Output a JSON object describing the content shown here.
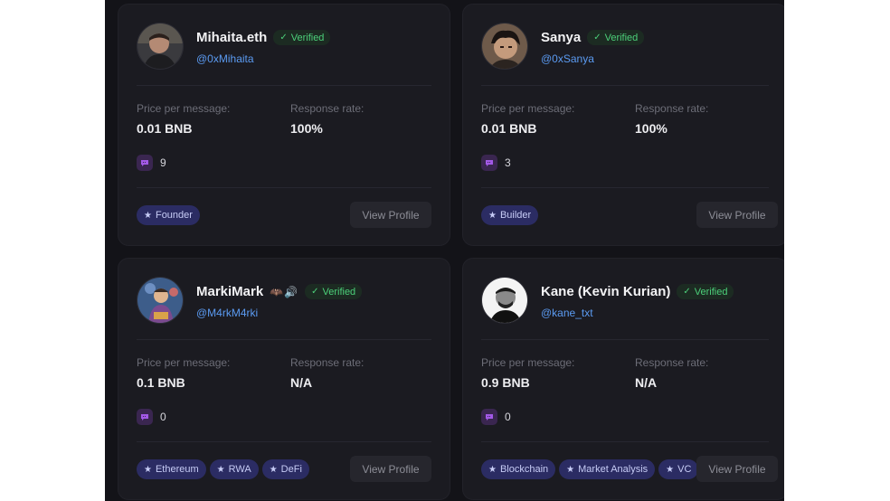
{
  "profiles": [
    {
      "name": "Mihaita.eth",
      "emoji": "",
      "verified_label": "Verified",
      "handle": "@0xMihaita",
      "price_label": "Price per message:",
      "price": "0.01 BNB",
      "response_label": "Response rate:",
      "response": "100%",
      "messages": "9",
      "tags": [
        "Founder"
      ],
      "button": "View Profile"
    },
    {
      "name": "Sanya",
      "emoji": "",
      "verified_label": "Verified",
      "handle": "@0xSanya",
      "price_label": "Price per message:",
      "price": "0.01 BNB",
      "response_label": "Response rate:",
      "response": "100%",
      "messages": "3",
      "tags": [
        "Builder"
      ],
      "button": "View Profile"
    },
    {
      "name": "MarkiMark",
      "emoji": "🦇🔊",
      "verified_label": "Verified",
      "handle": "@M4rkM4rki",
      "price_label": "Price per message:",
      "price": "0.1 BNB",
      "response_label": "Response rate:",
      "response": "N/A",
      "messages": "0",
      "tags": [
        "Ethereum",
        "RWA",
        "DeFi"
      ],
      "button": "View Profile"
    },
    {
      "name": "Kane (Kevin Kurian)",
      "emoji": "",
      "verified_label": "Verified",
      "handle": "@kane_txt",
      "price_label": "Price per message:",
      "price": "0.9 BNB",
      "response_label": "Response rate:",
      "response": "N/A",
      "messages": "0",
      "tags": [
        "Blockchain",
        "Market Analysis",
        "VC"
      ],
      "button": "View Profile"
    }
  ],
  "colors": {
    "background": "#131318",
    "card": "#1b1b21",
    "verified": "#4cd07a",
    "handle": "#5b9bf2",
    "tag_bg": "#2b2c63",
    "message_icon": "#a259e6"
  },
  "icons": {
    "verified": "checkmark-icon",
    "messages": "chat-bubble-icon",
    "tag": "star-icon"
  }
}
